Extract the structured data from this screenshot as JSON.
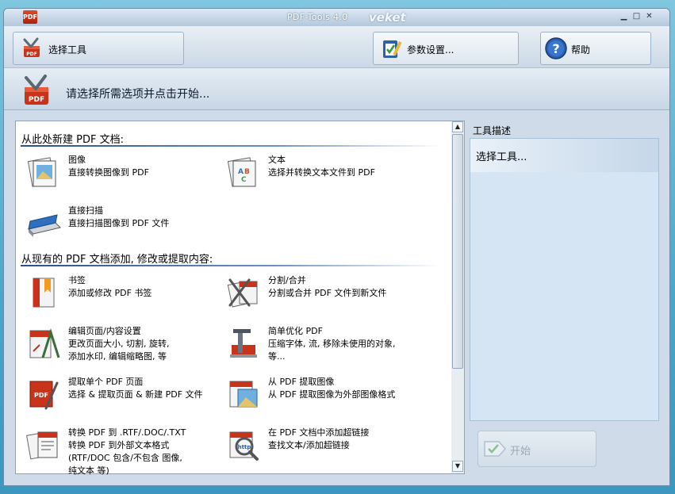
{
  "window": {
    "app_icon_label": "PDF",
    "title": "PDF-Tools 4.0",
    "brand": "veket"
  },
  "toolbar": {
    "select_tool": "选择工具",
    "settings": "参数设置...",
    "help": "帮助"
  },
  "header": {
    "prompt": "请选择所需选项并点击开始..."
  },
  "sections": {
    "new_pdf": "从此处新建 PDF 文档:",
    "existing_pdf": "从现有的 PDF 文档添加, 修改或提取内容:"
  },
  "items": {
    "image": {
      "title": "图像",
      "desc": [
        "直接转换图像到 PDF"
      ]
    },
    "text": {
      "title": "文本",
      "desc": [
        "选择并转换文本文件到 PDF"
      ]
    },
    "scan": {
      "title": "直接扫描",
      "desc": [
        "直接扫描图像到 PDF 文件"
      ]
    },
    "bookmark": {
      "title": "书签",
      "desc": [
        "添加或修改 PDF 书签"
      ]
    },
    "split": {
      "title": "分割/合并",
      "desc": [
        "分割或合并 PDF 文件到新文件"
      ]
    },
    "edit": {
      "title": "编辑页面/内容设置",
      "desc": [
        "更改页面大小, 切割, 旋转,",
        "添加水印, 编辑缩略图, 等"
      ]
    },
    "optimize": {
      "title": "简单优化 PDF",
      "desc": [
        "压缩字体, 流, 移除未使用的对象,",
        "等..."
      ]
    },
    "extract_page": {
      "title": "提取单个 PDF 页面",
      "desc": [
        "选择 & 提取页面 & 新建 PDF 文件"
      ]
    },
    "extract_image": {
      "title": "从 PDF 提取图像",
      "desc": [
        "从 PDF 提取图像为外部图像格式"
      ]
    },
    "convert": {
      "title": "转换 PDF 到 .RTF/.DOC/.TXT",
      "desc": [
        "转换 PDF 到外部文本格式",
        "(RTF/DOC 包含/不包含 图像,",
        "纯文本 等)"
      ]
    },
    "links": {
      "title": "在 PDF 文档中添加超链接",
      "desc": [
        "查找文本/添加超链接"
      ]
    }
  },
  "description": {
    "label": "工具描述",
    "text": "选择工具..."
  },
  "start_button": {
    "label": "开始",
    "enabled": false
  },
  "icons": {
    "app": "pdf-tools-app-icon",
    "select_tool": "toolbox-icon",
    "settings": "settings-clipboard-icon",
    "help": "help-question-icon",
    "start": "start-arrow-icon"
  },
  "colors": {
    "accent": "#2a4f8c",
    "desc_panel": "#d6e5f3",
    "pdf_red": "#c8331b"
  }
}
